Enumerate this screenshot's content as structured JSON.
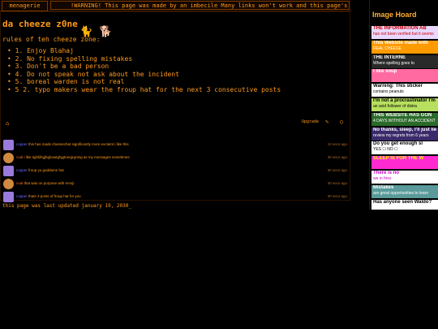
{
  "topbar": {
    "tab_label": "menagerie",
    "marquee_text": "!WARNING! This page was made by an imbecile Many links won't work and this page's :"
  },
  "main": {
    "title": "da cheeze z0ne",
    "rules_heading": "rules of teh cheeze zone:",
    "rules": [
      "1. Enjoy Blahaj",
      "2. No fixing spelling mistakes",
      "3. Don't be a bad person",
      "4. Do not speak not ask about the incident",
      "5. boreal warden is not real",
      "5 2. typo makers wear the froup hat for the next 3 consecutive posts"
    ]
  },
  "chat": {
    "upgrade_label": "Upgrade",
    "messages": [
      {
        "user": "copper",
        "text": "this has made cheesechat significantly more exclamt i like this",
        "time": "13 secs ago",
        "avatar_color": "#9a7adc"
      },
      {
        "user": "coal",
        "text": "i like tighliihgjhgbuwtghjgtrwrgrgning as my messages sometimes",
        "time": "30 secs ago",
        "avatar_color": "#d08a40"
      },
      {
        "user": "copper",
        "text": "froup yo goddamn hat",
        "time": "30 secs ago",
        "avatar_color": "#9a7adc"
      },
      {
        "user": "coal",
        "text": "that was on purpose with emoji",
        "time": "30 secs ago",
        "avatar_color": "#d08a40"
      },
      {
        "user": "copper",
        "text": "thats 3 posts of froup hat for you",
        "time": "30 secs ago",
        "avatar_color": "#9a7adc"
      }
    ]
  },
  "footer": {
    "updated": "this page was last updated january 19, 2030_"
  },
  "sidebar": {
    "title": "Image Hoard",
    "banners": [
      {
        "line1": "THE INFORMATION AB",
        "line2": "has not been verified but it seems",
        "bg": "#e8d8ff",
        "fg": "#c80000"
      },
      {
        "line1": "This Website made with",
        "line2": "REAL CHEESE",
        "bg": "#ff9a00",
        "fg": "#ffffff"
      },
      {
        "line1": "THE INTERNE",
        "line2": "Where spelling goes to",
        "bg": "#2a2a2a",
        "fg": "#ffffff"
      },
      {
        "line1": "I like soup",
        "line2": "",
        "bg": "#ff6aa0",
        "fg": "#ffffff"
      },
      {
        "line1": "Warning: This sticker",
        "line2": "contains peanuts",
        "bg": "#ffffff",
        "fg": "#000000"
      },
      {
        "line1": "I'm not a procrastinator I'm",
        "line2": "an avid follower of distra",
        "bg": "#b8e060",
        "fg": "#000000"
      },
      {
        "line1": "THIS WEBSITE HAS GON",
        "line2": "4 DAYS  WITHOUT AN ACCIDENT",
        "bg": "#2a6a2a",
        "fg": "#ffffff"
      },
      {
        "line1": "No thanks, sleep, I'll just lie",
        "line2": "review my regrets from 6 years",
        "bg": "#3a2a6a",
        "fg": "#ffffff"
      },
      {
        "line1": "Do you get enough sl",
        "line2": "YES ☐    NO ☐",
        "bg": "#ffffff",
        "fg": "#000000"
      },
      {
        "line1": "SLEEP IS FOR THE W",
        "line2": "",
        "bg": "#ff2ad0",
        "fg": "#ffff00"
      },
      {
        "line1": "There is no",
        "line2": "we in fries",
        "bg": "#ffffff",
        "fg": "#c800c8"
      },
      {
        "line1": "Mistakes",
        "line2": "are great opportunities to learn",
        "bg": "#5a9a9a",
        "fg": "#ffffff"
      },
      {
        "line1": "Has anyone seen Waldo?",
        "line2": "",
        "bg": "#ffffff",
        "fg": "#000000"
      }
    ]
  }
}
